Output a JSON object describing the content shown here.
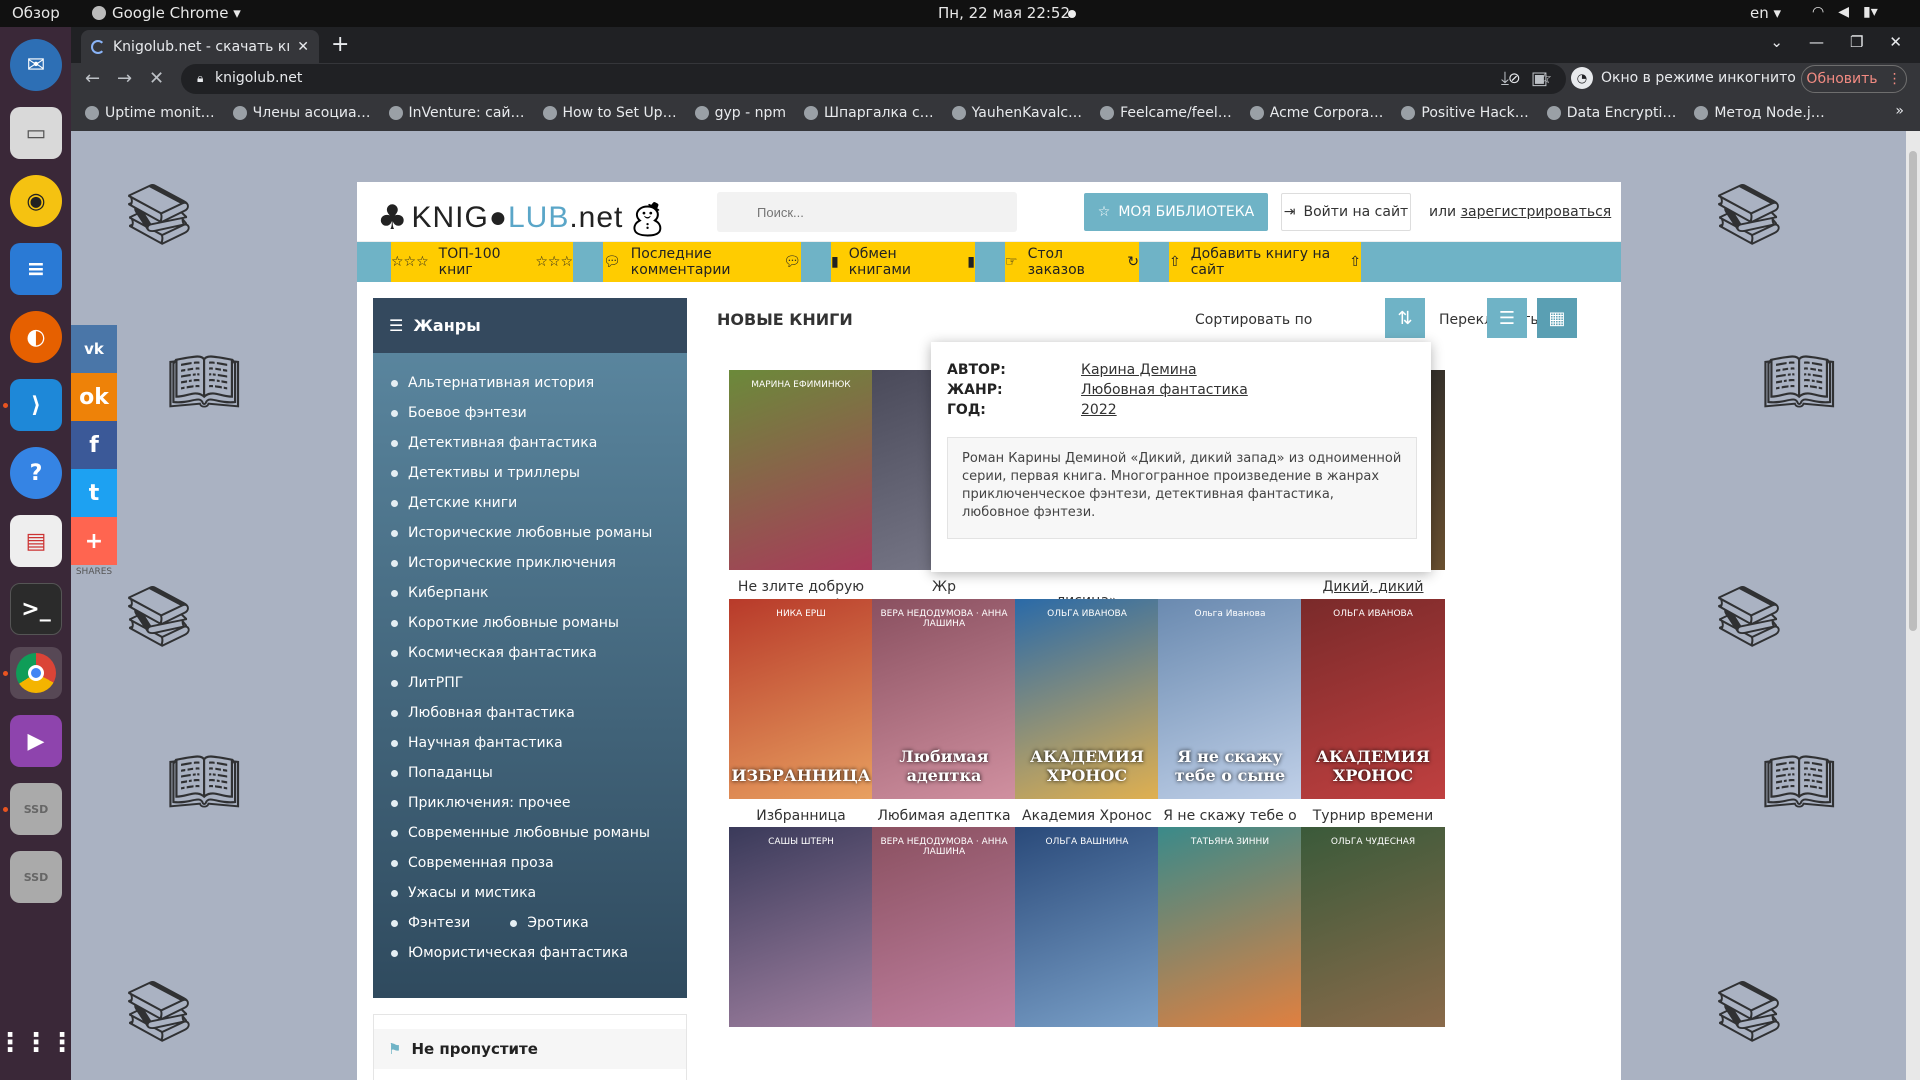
{
  "system": {
    "overview": "Обзор",
    "app_name": "Google Chrome ▾",
    "clock": "Пн, 22 мая  22:52",
    "lang": "en ▾"
  },
  "browser": {
    "tab_title": "Knigolub.net - скачать кни",
    "url": "knigolub.net",
    "incognito": "Окно в режиме инкогнито",
    "refresh": "Обновить",
    "bookmarks": [
      "Uptime monit…",
      "Члены асоциа…",
      "InVenture: сай…",
      "How to Set Up…",
      "gyp - npm",
      "Шпаргалка с…",
      "YauhenKavalc…",
      "Feelcame/feel…",
      "Acme Corpora…",
      "Positive Hack…",
      "Data Encrypti…",
      "Метод Node.j…"
    ]
  },
  "share": {
    "label": "SHARES"
  },
  "site": {
    "logo_part1": "KNIG",
    "logo_part2": "LUB",
    "logo_part3": ".net",
    "search_placeholder": "Поиск...",
    "library_btn": "МОЯ БИБЛИОТЕКА",
    "login_btn": "Войти на сайт",
    "register_prefix": "или ",
    "register_link": "зарегистрироваться",
    "nav": [
      "ТОП-100 книг",
      "Последние комментарии",
      "Обмен книгами",
      "Стол заказов",
      "Добавить книгу на сайт"
    ]
  },
  "sidebar": {
    "genres_title": "Жанры",
    "genres": [
      "Альтернативная история",
      "Боевое фэнтези",
      "Детективная фантастика",
      "Детективы и триллеры",
      "Детские книги",
      "Исторические любовные романы",
      "Исторические приключения",
      "Киберпанк",
      "Короткие любовные романы",
      "Космическая фантастика",
      "ЛитРПГ",
      "Любовная фантастика",
      "Научная фантастика",
      "Попаданцы",
      "Приключения: прочее",
      "Современные любовные романы",
      "Современная проза",
      "Ужасы и мистика"
    ],
    "genre_pair": [
      "Фэнтези",
      "Эротика"
    ],
    "genre_last": "Юмористическая фантастика",
    "notmiss_title": "Не пропустите"
  },
  "main": {
    "section_title": "НОВЫЕ КНИГИ",
    "sort_label": "Сортировать по",
    "switch_label": "Переключить вид:",
    "row1": [
      {
        "title": "Не злите добрую колдунью!",
        "cover_author": "МАРИНА ЕФИМИНЮК",
        "color1": "#6b8a3a",
        "color2": "#a83a5a"
      },
      {
        "title": "Жр",
        "cover_author": "",
        "color1": "#4a4a5a",
        "color2": "#7a7a8a"
      },
      {
        "title": "лисица»",
        "cover_author": "",
        "color1": "#ffffff",
        "color2": "#ffffff"
      },
      {
        "title": "",
        "cover_author": "",
        "color1": "#ffffff",
        "color2": "#ffffff"
      },
      {
        "title": "Дикий, дикий запад",
        "cover_author": "Карина Демина",
        "cover_text": "ДИКИЙ, ДИКИЙ ЗАПАД",
        "color1": "#2a2a2a",
        "color2": "#6a5030"
      }
    ],
    "row2": [
      {
        "title": "Избранница Мастера рун",
        "cover_author": "НИКА ЕРШ",
        "cover_text": "ИЗБРАННИЦА",
        "color1": "#b83a2a",
        "color2": "#e8a060"
      },
      {
        "title": "Любимая адептка Его Величества.",
        "cover_author": "ВЕРА НЕДОДУМОВА · АННА ЛАШИНА",
        "cover_text": "Любимая адептка",
        "color1": "#8a5060",
        "color2": "#d090a0"
      },
      {
        "title": "Академия Хронос",
        "cover_author": "ОЛЬГА ИВАНОВА",
        "cover_text": "АКАДЕМИЯ ХРОНОС",
        "color1": "#2a6aa8",
        "color2": "#e0b050"
      },
      {
        "title": "Я не скажу тебе о сыне",
        "cover_author": "Ольга Иванова",
        "cover_text": "Я не скажу тебе о сыне",
        "color1": "#6a8ab0",
        "color2": "#c0d0e8"
      },
      {
        "title": "Турнир времени",
        "cover_author": "ОЛЬГА ИВАНОВА",
        "cover_text": "АКАДЕМИЯ ХРОНОС",
        "color1": "#7a2a2a",
        "color2": "#c04040"
      }
    ],
    "row3": [
      {
        "cover_author": "САШЫ ШТЕРН",
        "color1": "#3a3a5a",
        "color2": "#a080a0"
      },
      {
        "cover_author": "ВЕРА НЕДОДУМОВА · АННА ЛАШИНА",
        "color1": "#8a5060",
        "color2": "#c080a0"
      },
      {
        "cover_author": "ОЛЬГА ВАШНИНА",
        "color1": "#2a4a7a",
        "color2": "#7aa0c8"
      },
      {
        "cover_author": "ТАТЬЯНА ЗИННИ",
        "color1": "#3a8a8a",
        "color2": "#e08040"
      },
      {
        "cover_author": "ОЛЬГА ЧУДЕСНАЯ",
        "color1": "#3a5a3a",
        "color2": "#8a6a4a"
      }
    ]
  },
  "tooltip": {
    "author_label": "АВТОР:",
    "author": "Карина Демина",
    "genre_label": "ЖАНР:",
    "genre": "Любовная фантастика",
    "year_label": "ГОД:",
    "year": "2022",
    "description": "Роман Карины Деминой «Дикий, дикий запад» из одноименной серии, первая книга. Многогранное произведение в жанрах приключенческое фэнтези, детективная фантастика, любовное фэнтези."
  }
}
